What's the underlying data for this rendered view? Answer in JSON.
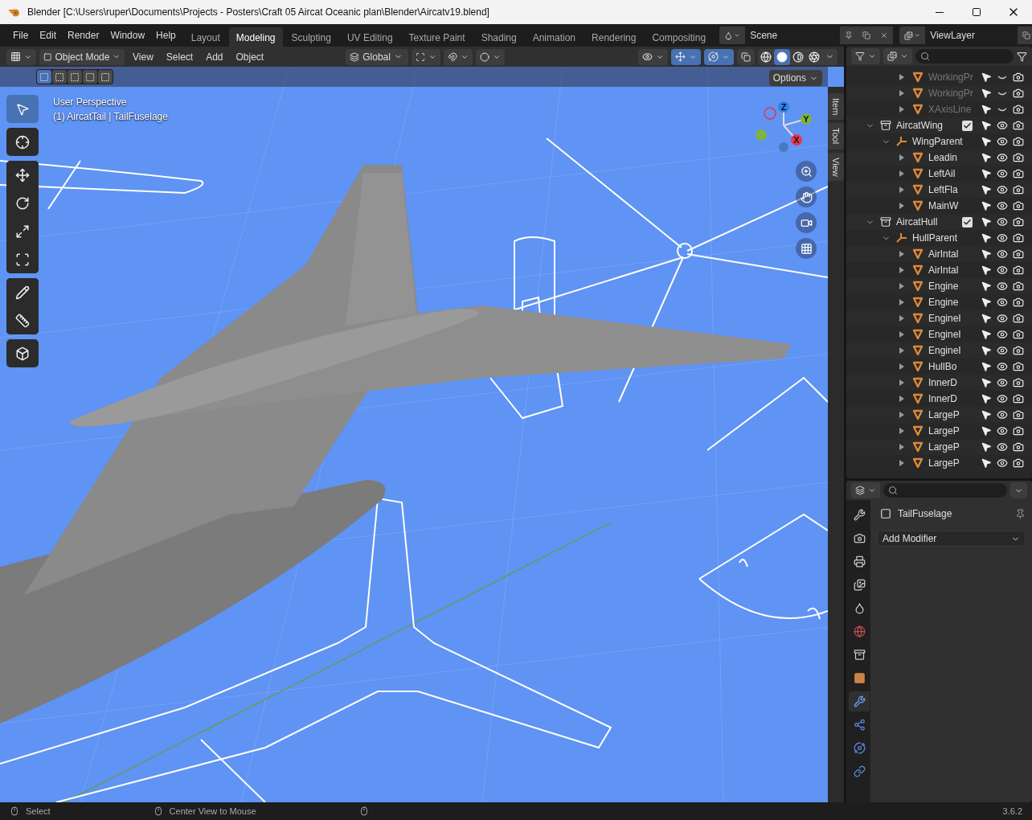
{
  "window": {
    "title": "Blender [C:\\Users\\ruper\\Documents\\Projects - Posters\\Craft 05 Aircat Oceanic plan\\Blender\\Aircatv19.blend]"
  },
  "menu": [
    "File",
    "Edit",
    "Render",
    "Window",
    "Help"
  ],
  "workspaces": [
    {
      "label": "Layout",
      "selected": false
    },
    {
      "label": "Modeling",
      "selected": true
    },
    {
      "label": "Sculpting",
      "selected": false
    },
    {
      "label": "UV Editing",
      "selected": false
    },
    {
      "label": "Texture Paint",
      "selected": false
    },
    {
      "label": "Shading",
      "selected": false
    },
    {
      "label": "Animation",
      "selected": false
    },
    {
      "label": "Rendering",
      "selected": false
    },
    {
      "label": "Compositing",
      "selected": false
    }
  ],
  "scene": {
    "label": "Scene"
  },
  "view_layer": {
    "label": "ViewLayer"
  },
  "viewport_header": {
    "mode": "Object Mode",
    "menus": [
      "View",
      "Select",
      "Add",
      "Object"
    ],
    "orientation": "Global",
    "shading_modes": [
      {
        "kind": "wireframe",
        "selected": false
      },
      {
        "kind": "solid",
        "selected": true
      },
      {
        "kind": "material",
        "selected": false
      },
      {
        "kind": "rendered",
        "selected": false
      }
    ]
  },
  "viewport": {
    "selection_modes": [
      {
        "selected": true
      },
      {
        "selected": false
      },
      {
        "selected": false
      },
      {
        "selected": false
      },
      {
        "selected": false
      }
    ],
    "options": "Options",
    "perspective": "User Perspective",
    "object_info": "(1) AircatTail | TailFuselage",
    "side_tabs": [
      "Item",
      "Tool",
      "View"
    ],
    "gizmo_axes": [
      {
        "label": "Z",
        "color": "#2f83e8"
      },
      {
        "label": "Y",
        "color": "#7cb342"
      },
      {
        "label": "X",
        "color": "#e8364f"
      }
    ],
    "tools": [
      {
        "kind": "select",
        "selected": true
      },
      {
        "kind": "cursor",
        "selected": false
      },
      {
        "kind": "move",
        "selected": false
      },
      {
        "kind": "rotate",
        "selected": false
      },
      {
        "kind": "scale",
        "selected": false
      },
      {
        "kind": "transform",
        "selected": false
      },
      {
        "kind": "annotate",
        "selected": false
      },
      {
        "kind": "measure",
        "selected": false
      },
      {
        "kind": "add-cube",
        "selected": false
      }
    ]
  },
  "outliner": {
    "scrolled_rows": [
      {
        "name": "WorkingPr",
        "kind": "mesh",
        "expanded": false,
        "hidden": true
      },
      {
        "name": "WorkingPr",
        "kind": "mesh",
        "expanded": false,
        "hidden": true
      },
      {
        "name": "XAxisLine",
        "kind": "mesh",
        "expanded": false,
        "hidden": true
      }
    ],
    "items": [
      {
        "name": "AircatWing",
        "kind": "collection",
        "expanded": true,
        "checked": true,
        "hidden": false,
        "children": [
          {
            "name": "WingParent",
            "kind": "empty",
            "expanded": true,
            "hidden": false,
            "children": [
              {
                "name": "Leadin",
                "kind": "mesh",
                "expanded": false,
                "hidden": false
              },
              {
                "name": "LeftAil",
                "kind": "mesh",
                "expanded": false,
                "hidden": false
              },
              {
                "name": "LeftFla",
                "kind": "mesh",
                "expanded": false,
                "hidden": false
              },
              {
                "name": "MainW",
                "kind": "mesh",
                "expanded": false,
                "hidden": false
              }
            ]
          }
        ]
      },
      {
        "name": "AircatHull",
        "kind": "collection",
        "expanded": true,
        "checked": true,
        "hidden": false,
        "children": [
          {
            "name": "HullParent",
            "kind": "empty",
            "expanded": true,
            "hidden": false,
            "children": [
              {
                "name": "AirIntal",
                "kind": "mesh",
                "expanded": false,
                "hidden": false
              },
              {
                "name": "AirIntal",
                "kind": "mesh",
                "expanded": false,
                "hidden": false
              },
              {
                "name": "Engine",
                "kind": "mesh",
                "expanded": false,
                "hidden": false
              },
              {
                "name": "Engine",
                "kind": "mesh",
                "expanded": false,
                "hidden": false
              },
              {
                "name": "EngineI",
                "kind": "mesh",
                "expanded": false,
                "hidden": false
              },
              {
                "name": "EngineI",
                "kind": "mesh",
                "expanded": false,
                "hidden": false
              },
              {
                "name": "EngineI",
                "kind": "mesh",
                "expanded": false,
                "hidden": false
              },
              {
                "name": "HullBo",
                "kind": "mesh",
                "expanded": false,
                "hidden": false
              },
              {
                "name": "InnerD",
                "kind": "mesh",
                "expanded": false,
                "hidden": false
              },
              {
                "name": "InnerD",
                "kind": "mesh",
                "expanded": false,
                "hidden": false
              },
              {
                "name": "LargeP",
                "kind": "mesh",
                "expanded": false,
                "hidden": false
              },
              {
                "name": "LargeP",
                "kind": "mesh",
                "expanded": false,
                "hidden": false
              },
              {
                "name": "LargeP",
                "kind": "mesh",
                "expanded": false,
                "hidden": false
              },
              {
                "name": "LargeP",
                "kind": "mesh",
                "expanded": false,
                "hidden": false
              }
            ]
          }
        ]
      }
    ]
  },
  "properties": {
    "object_name": "TailFuselage",
    "add_modifier": "Add Modifier",
    "tabs": [
      {
        "kind": "tool",
        "selected": false
      },
      {
        "kind": "render",
        "selected": false
      },
      {
        "kind": "output",
        "selected": false
      },
      {
        "kind": "view-layer",
        "selected": false
      },
      {
        "kind": "scene",
        "selected": false
      },
      {
        "kind": "world",
        "selected": false
      },
      {
        "kind": "collection",
        "selected": false
      },
      {
        "kind": "object",
        "selected": false
      },
      {
        "kind": "modifier",
        "selected": true
      },
      {
        "kind": "particles",
        "selected": false
      },
      {
        "kind": "physics",
        "selected": false
      },
      {
        "kind": "constraints",
        "selected": false
      }
    ]
  },
  "status_bar": {
    "hints": [
      "Select",
      "Center View to Mouse"
    ],
    "version": "3.6.2"
  }
}
